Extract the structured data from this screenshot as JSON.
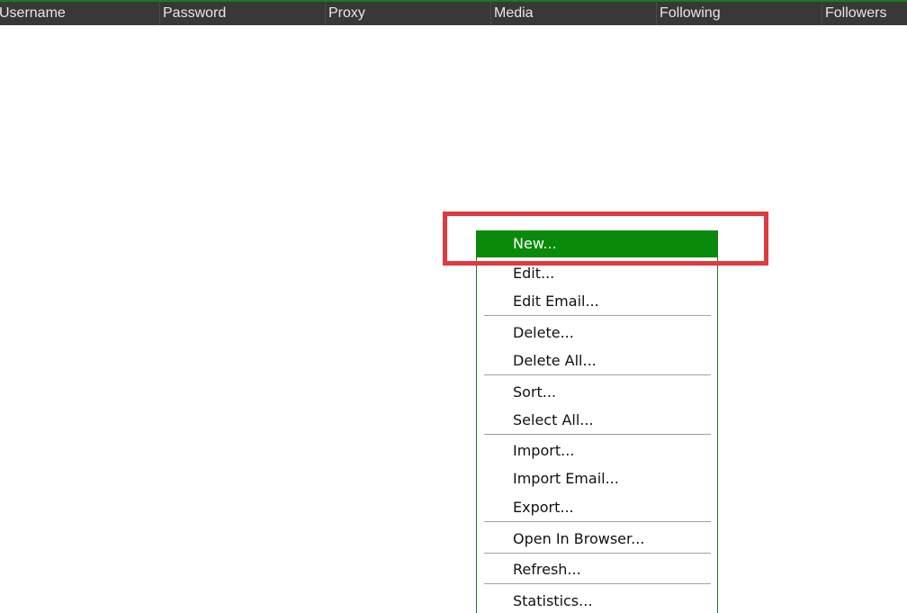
{
  "table": {
    "columns": [
      "Username",
      "Password",
      "Proxy",
      "Media",
      "Following",
      "Followers"
    ]
  },
  "context_menu": {
    "items": [
      {
        "label": "New...",
        "active": true
      },
      {
        "label": "Edit..."
      },
      {
        "label": "Edit Email..."
      },
      {
        "label": "Delete..."
      },
      {
        "label": "Delete All..."
      },
      {
        "label": "Sort..."
      },
      {
        "label": "Select All..."
      },
      {
        "label": "Import..."
      },
      {
        "label": "Import Email..."
      },
      {
        "label": "Export..."
      },
      {
        "label": "Open In Browser..."
      },
      {
        "label": "Refresh..."
      },
      {
        "label": "Statistics..."
      }
    ]
  },
  "colors": {
    "header_bg": "#383838",
    "accent_green": "#0a8a0a",
    "highlight_red": "#e0393e"
  }
}
